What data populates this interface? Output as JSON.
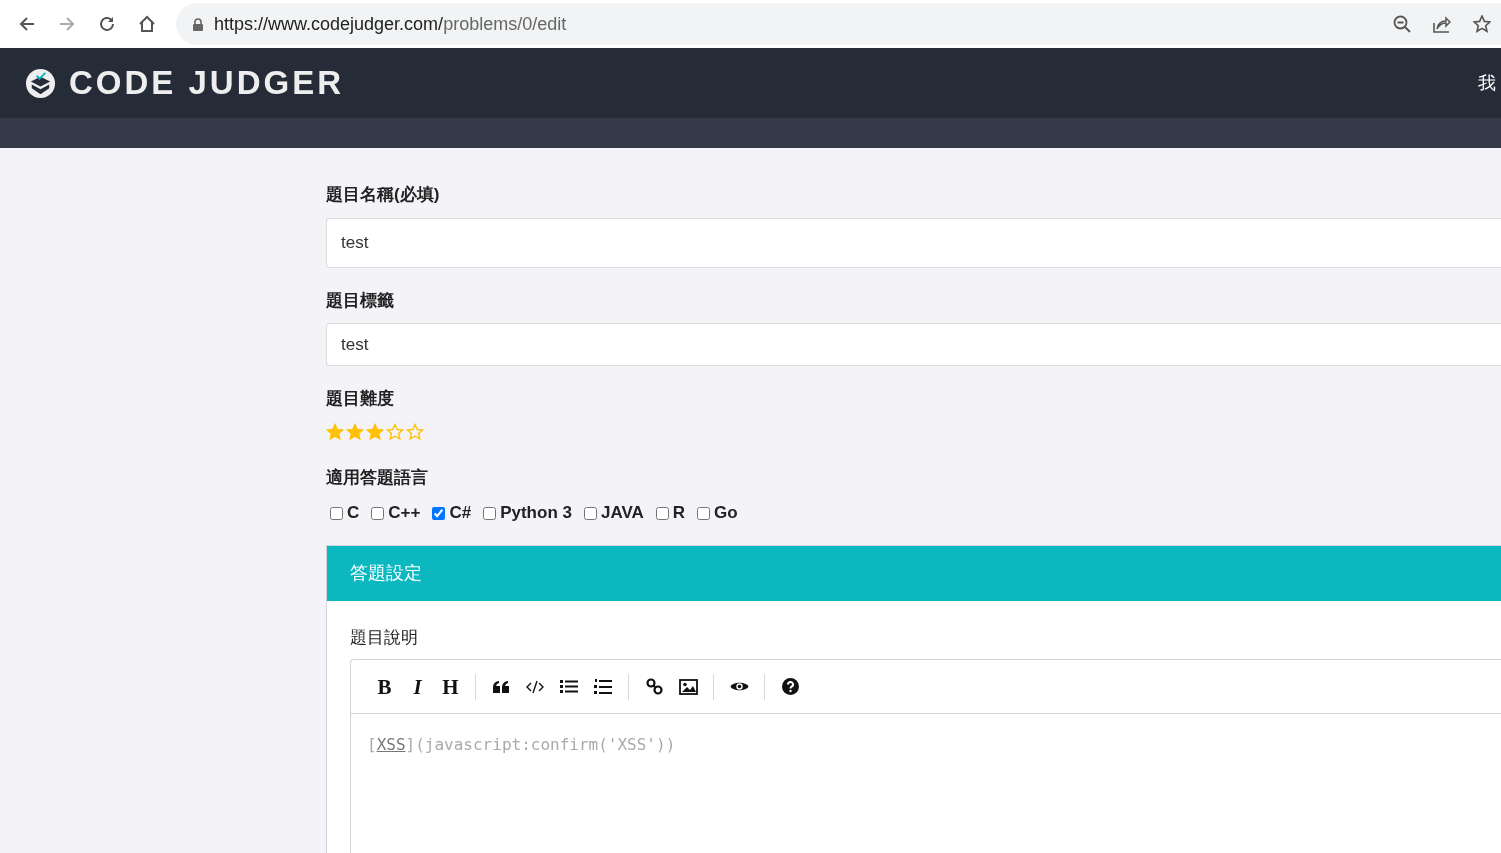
{
  "browser": {
    "url_host": "https://www.codejudger.com/",
    "url_path": "problems/0/edit"
  },
  "navbar": {
    "brand": "CODE JUDGER",
    "menu_item": "我"
  },
  "form": {
    "title_label": "題目名稱(必填)",
    "title_value": "test",
    "tags_label": "題目標籤",
    "tags_value": "test",
    "difficulty_label": "題目難度",
    "difficulty": {
      "stars": 3
    },
    "languages_label": "適用答題語言",
    "languages": [
      {
        "label": "C",
        "checked": false
      },
      {
        "label": "C++",
        "checked": false
      },
      {
        "label": "C#",
        "checked": true
      },
      {
        "label": "Python 3",
        "checked": false
      },
      {
        "label": "JAVA",
        "checked": false
      },
      {
        "label": "R",
        "checked": false
      },
      {
        "label": "Go",
        "checked": false
      }
    ]
  },
  "card": {
    "title": "答題設定",
    "description_label": "題目說明",
    "toolbar": [
      {
        "kind": "bold",
        "label": "B"
      },
      {
        "kind": "italic",
        "label": "I"
      },
      {
        "kind": "heading",
        "label": "H"
      },
      {
        "kind": "separator"
      },
      {
        "kind": "quote"
      },
      {
        "kind": "code"
      },
      {
        "kind": "ul"
      },
      {
        "kind": "ol"
      },
      {
        "kind": "separator"
      },
      {
        "kind": "link"
      },
      {
        "kind": "image"
      },
      {
        "kind": "separator"
      },
      {
        "kind": "preview"
      },
      {
        "kind": "separator"
      },
      {
        "kind": "help"
      }
    ],
    "editor": {
      "prefix": "[",
      "link_text": "XSS",
      "suffix": "](javascript:confirm('XSS'))"
    }
  }
}
